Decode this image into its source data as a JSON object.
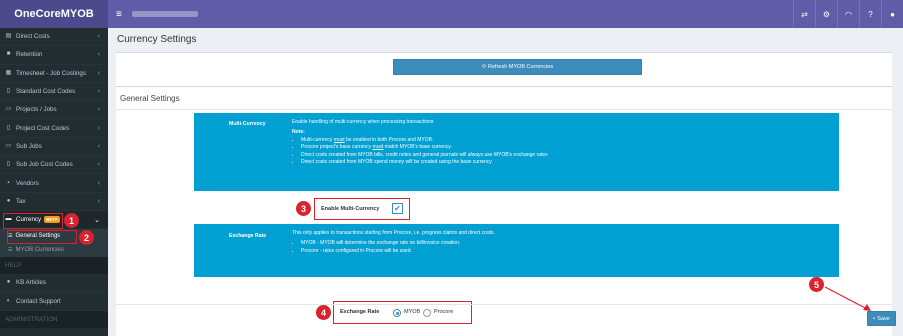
{
  "app": {
    "brand": "OneCoreMYOB"
  },
  "sidebar": {
    "items": [
      {
        "label": "Direct Costs",
        "icon": "cart-icon"
      },
      {
        "label": "Retention",
        "icon": "lock-icon"
      },
      {
        "label": "Timesheet - Job Costings",
        "icon": "calendar-icon"
      },
      {
        "label": "Standard Cost Codes",
        "icon": "file-icon"
      },
      {
        "label": "Projects / Jobs",
        "icon": "folder-icon"
      },
      {
        "label": "Project Cost Codes",
        "icon": "file-icon"
      },
      {
        "label": "Sub Jobs",
        "icon": "folder-icon"
      },
      {
        "label": "Sub Job Cost Codes",
        "icon": "file-icon"
      },
      {
        "label": "Vendors",
        "icon": "briefcase-icon"
      },
      {
        "label": "Tax",
        "icon": "tax-icon"
      }
    ],
    "currency": {
      "label": "Currency",
      "badge": "BETA"
    },
    "currency_sub": [
      {
        "label": "General Settings"
      },
      {
        "label": "MYOB Currencies"
      }
    ],
    "help_header": "HELP",
    "help_items": [
      {
        "label": "KB Articles"
      },
      {
        "label": "Contact Support"
      }
    ],
    "admin_header": "ADMINISTRATION"
  },
  "topbar": {
    "icons": [
      "transfer-icon",
      "gears-icon",
      "headset-icon",
      "question-icon",
      "user-icon"
    ]
  },
  "page": {
    "title": "Currency Settings"
  },
  "refresh": {
    "label": "⟳ Refresh MYOB Currencies"
  },
  "general": {
    "title": "General Settings"
  },
  "multi": {
    "label": "Multi-Currency",
    "desc": "Enable handling of multi-currency when processing transactions",
    "note_label": "Note:",
    "notes": [
      [
        "Multi-currency ",
        "must",
        " be enabled in both Procore and MYOB."
      ],
      [
        "Procore project's base currency ",
        "must",
        " match MYOB's base currency."
      ],
      [
        "Direct costs created from MYOB bills, credit notes and general journals will always use MYOB's exchange rates",
        "",
        ""
      ],
      [
        "Direct costs created from MYOB spend money will be created using the base currency",
        "",
        ""
      ]
    ]
  },
  "enable": {
    "label": "Enable Multi-Currency",
    "checked": true
  },
  "exchange": {
    "label": "Exchange Rate",
    "desc": "This only applies to transactions starting from Procore, i.e. progress claims and direct costs.",
    "bullets": [
      "MYOB - MYOB will determine the exchange rate on bill/invoice creation.",
      "Procore - rates configured in Procore will be used."
    ],
    "field_label": "Exchange Rate",
    "options": [
      {
        "label": "MYOB",
        "selected": true
      },
      {
        "label": "Procore",
        "selected": false
      }
    ]
  },
  "save": {
    "label": "Save"
  },
  "annotations": [
    "1",
    "2",
    "3",
    "4",
    "5"
  ],
  "colors": {
    "brand": "#4c4a8d",
    "topbar": "#605ca8",
    "sidebar": "#222d32",
    "info": "#00a0d2",
    "button": "#3c8dbc",
    "callout": "#d9232e"
  }
}
